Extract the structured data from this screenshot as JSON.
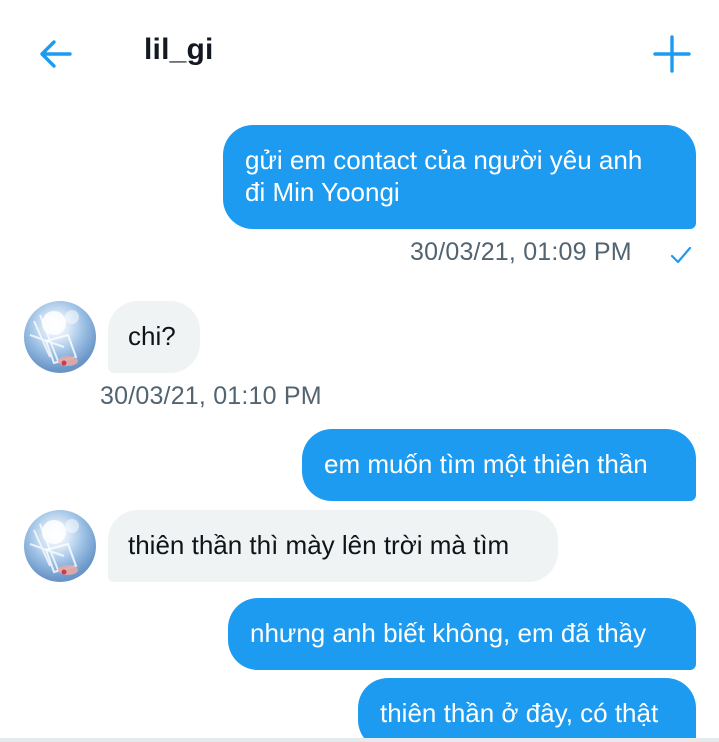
{
  "header": {
    "title": "lil_gi",
    "back_icon": "arrow-left-icon",
    "add_icon": "plus-icon",
    "accent_color": "#1d9bf0"
  },
  "messages": [
    {
      "direction": "outgoing",
      "text": "gửi em contact của người yêu anh\nđi Min Yoongi",
      "timestamp": "30/03/21, 01:09 PM",
      "status_icon": "check-icon"
    },
    {
      "direction": "incoming",
      "text": "chi?",
      "timestamp": "30/03/21, 01:10 PM",
      "avatar": "avatar"
    },
    {
      "direction": "outgoing",
      "text": "em muốn tìm một thiên thần"
    },
    {
      "direction": "incoming",
      "text": "thiên thần thì mày lên trời mà tìm",
      "avatar": "avatar"
    },
    {
      "direction": "outgoing",
      "text": "nhưng anh biết không, em đã thầy"
    },
    {
      "direction": "outgoing",
      "text": "thiên thần ở đây, có thật"
    }
  ]
}
